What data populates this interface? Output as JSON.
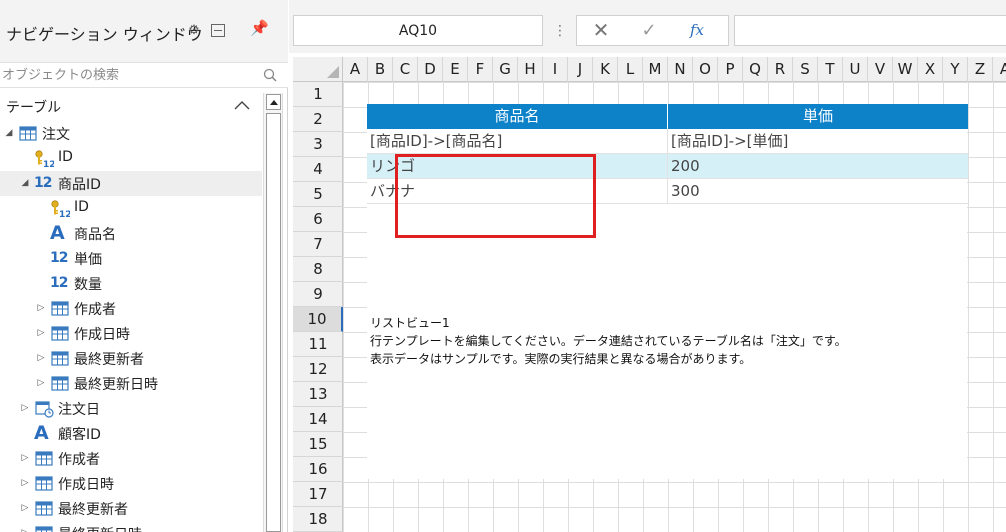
{
  "nav": {
    "title": "ナビゲーション ウィンドウ",
    "search_placeholder": "オブジェクトの検索",
    "section_label": "テーブル",
    "items": [
      {
        "label": "注文",
        "icon": "table-icon",
        "indent": 0,
        "arrow": "expanded"
      },
      {
        "label": "ID",
        "icon": "key-number-icon",
        "indent": 1,
        "arrow": "none"
      },
      {
        "label": "商品ID",
        "icon": "number-icon",
        "indent": 1,
        "arrow": "expanded",
        "selected": true
      },
      {
        "label": "ID",
        "icon": "key-number-icon",
        "indent": 2,
        "arrow": "none"
      },
      {
        "label": "商品名",
        "icon": "text-icon",
        "indent": 2,
        "arrow": "none"
      },
      {
        "label": "単価",
        "icon": "number-icon",
        "indent": 2,
        "arrow": "none"
      },
      {
        "label": "数量",
        "icon": "number-icon",
        "indent": 2,
        "arrow": "none"
      },
      {
        "label": "作成者",
        "icon": "table-icon",
        "indent": 2,
        "arrow": "collapsed"
      },
      {
        "label": "作成日時",
        "icon": "table-icon",
        "indent": 2,
        "arrow": "collapsed"
      },
      {
        "label": "最終更新者",
        "icon": "table-icon",
        "indent": 2,
        "arrow": "collapsed"
      },
      {
        "label": "最終更新日時",
        "icon": "table-icon",
        "indent": 2,
        "arrow": "collapsed"
      },
      {
        "label": "注文日",
        "icon": "date-icon",
        "indent": 1,
        "arrow": "collapsed"
      },
      {
        "label": "顧客ID",
        "icon": "text-icon",
        "indent": 1,
        "arrow": "none"
      },
      {
        "label": "作成者",
        "icon": "table-icon",
        "indent": 1,
        "arrow": "collapsed"
      },
      {
        "label": "作成日時",
        "icon": "table-icon",
        "indent": 1,
        "arrow": "collapsed"
      },
      {
        "label": "最終更新者",
        "icon": "table-icon",
        "indent": 1,
        "arrow": "collapsed"
      },
      {
        "label": "最終更新日時",
        "icon": "table-icon",
        "indent": 1,
        "arrow": "collapsed"
      }
    ]
  },
  "formula_bar": {
    "cell_ref": "AQ10",
    "fx_label": "fx"
  },
  "sheet": {
    "columns": [
      "A",
      "B",
      "C",
      "D",
      "E",
      "F",
      "G",
      "H",
      "I",
      "J",
      "K",
      "L",
      "M",
      "N",
      "O",
      "P",
      "Q",
      "R",
      "S",
      "T",
      "U",
      "V",
      "W",
      "X",
      "Y",
      "Z",
      "A"
    ],
    "rows": [
      "1",
      "2",
      "3",
      "4",
      "5",
      "6",
      "7",
      "8",
      "9",
      "10",
      "11",
      "12",
      "13",
      "14",
      "15",
      "16",
      "17",
      "18"
    ],
    "active_row": "10",
    "header_bg": "#0e82c9",
    "selected_row_bg": "#d6f0f8",
    "highlight_color": "#e02020"
  },
  "listview": {
    "headers": [
      "商品名",
      "単価"
    ],
    "template_row": [
      "[商品ID]->[商品名]",
      "[商品ID]->[単価]"
    ],
    "data_rows": [
      [
        "リンゴ",
        "200"
      ],
      [
        "バナナ",
        "300"
      ]
    ],
    "description": [
      "リストビュー1",
      "行テンプレートを編集してください。データ連結されているテーブル名は「注文」です。",
      "表示データはサンプルです。実際の実行結果と異なる場合があります。"
    ]
  }
}
